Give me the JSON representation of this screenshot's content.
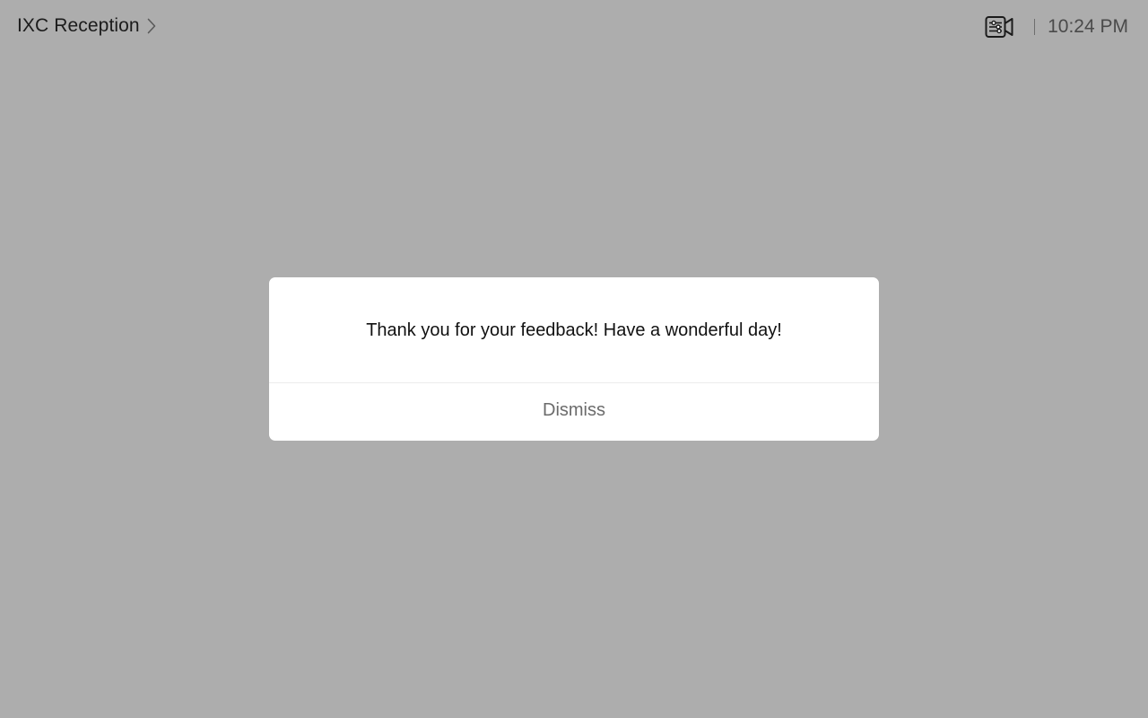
{
  "topbar": {
    "room_name": "IXC Reception",
    "chevron_icon": "chevron-right-icon",
    "camera_icon": "camera-settings-icon",
    "time": "10:24 PM"
  },
  "dialog": {
    "message": "Thank you for your feedback! Have a wonderful day!",
    "dismiss_label": "Dismiss"
  },
  "colors": {
    "background": "#adadad",
    "dialog_background": "#ffffff",
    "primary_text": "#111111",
    "secondary_text": "#6b6b6b"
  }
}
